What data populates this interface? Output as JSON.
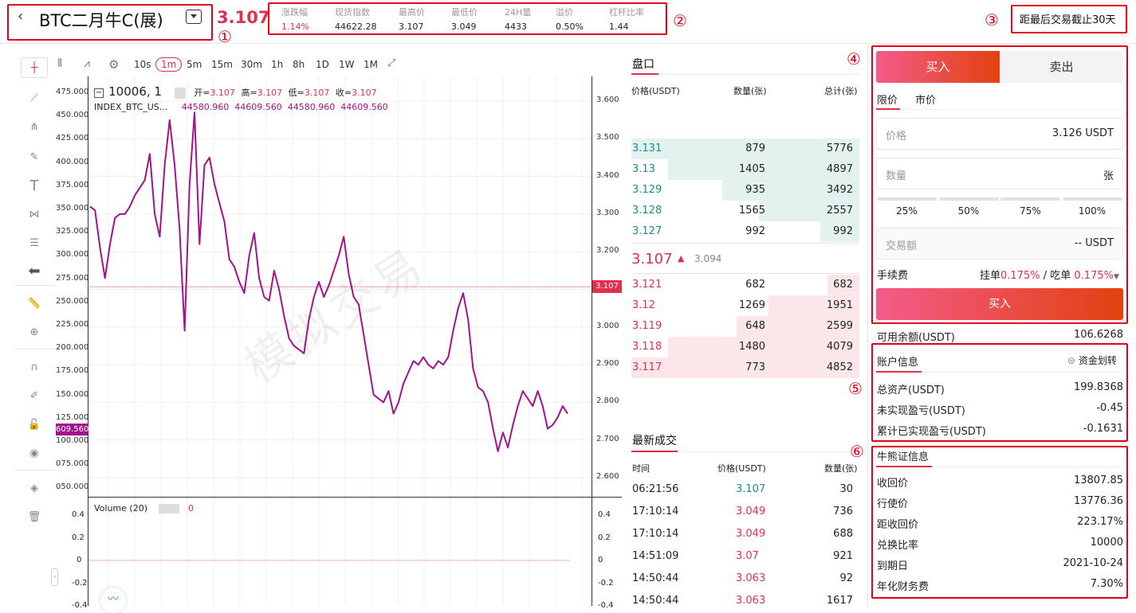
{
  "header": {
    "title": "BTC二月牛C(展)",
    "price": "3.107",
    "stats": [
      {
        "label": "涨跌幅",
        "value": "1.14%",
        "red": true
      },
      {
        "label": "现货指数",
        "value": "44622.28"
      },
      {
        "label": "最高价",
        "value": "3.107"
      },
      {
        "label": "最低价",
        "value": "3.049"
      },
      {
        "label": "24H量",
        "value": "4433"
      },
      {
        "label": "溢价",
        "value": "0.50%"
      },
      {
        "label": "杠杆比率",
        "value": "1.44"
      }
    ],
    "countdown": "距最后交易截止30天"
  },
  "markers": [
    "①",
    "②",
    "③",
    "④",
    "⑤",
    "⑥"
  ],
  "chart": {
    "timeframes": [
      "10s",
      "1m",
      "5m",
      "15m",
      "30m",
      "1h",
      "8h",
      "1D",
      "1W",
      "1M"
    ],
    "active_timeframe": "1m",
    "symbol": "10006, 1",
    "ohlc_open_label": "开=",
    "ohlc_open": "3.107",
    "ohlc_high_label": "高=",
    "ohlc_high": "3.107",
    "ohlc_low_label": "低=",
    "ohlc_low": "3.107",
    "ohlc_close_label": "收=",
    "ohlc_close": "3.107",
    "index_name": "INDEX_BTC_US...",
    "index_values": "44580.960  44609.560  44580.960  44609.560",
    "watermark": "模拟交易",
    "right_axis": [
      "3.600",
      "3.500",
      "3.400",
      "3.300",
      "3.200",
      "3.100",
      "3.000",
      "2.900",
      "2.800",
      "2.700",
      "2.600"
    ],
    "left_axis": [
      "475.000",
      "450.000",
      "425.000",
      "400.000",
      "375.000",
      "350.000",
      "325.000",
      "300.000",
      "275.000",
      "250.000",
      "225.000",
      "200.000",
      "175.000",
      "150.000",
      "125.000",
      "100.000",
      "075.000",
      "050.000"
    ],
    "current_price_tag": "3.107",
    "left_price_tag": "609.560",
    "volume_label": "Volume (20)",
    "volume_value": "0",
    "volume_axis": [
      "0.4",
      "0.2",
      "0",
      "-0.2",
      "-0.4"
    ],
    "series": [
      3.32,
      3.31,
      3.21,
      3.13,
      3.22,
      3.29,
      3.3,
      3.3,
      3.32,
      3.35,
      3.37,
      3.39,
      3.46,
      3.3,
      3.24,
      3.43,
      3.55,
      3.43,
      3.26,
      2.99,
      3.38,
      3.57,
      3.22,
      3.43,
      3.45,
      3.38,
      3.33,
      3.28,
      3.18,
      3.16,
      3.12,
      3.09,
      3.19,
      3.25,
      3.13,
      3.08,
      3.07,
      3.15,
      3.1,
      3.03,
      2.97,
      2.95,
      2.94,
      2.93,
      3.02,
      3.08,
      3.12,
      3.08,
      3.11,
      3.15,
      3.19,
      3.24,
      3.14,
      3.08,
      3.06,
      2.98,
      2.9,
      2.82,
      2.81,
      2.8,
      2.83,
      2.77,
      2.8,
      2.85,
      2.88,
      2.91,
      2.9,
      2.92,
      2.9,
      2.89,
      2.91,
      2.9,
      2.92,
      2.99,
      3.05,
      3.09,
      3.02,
      2.89,
      2.84,
      2.83,
      2.8,
      2.73,
      2.67,
      2.72,
      2.68,
      2.74,
      2.79,
      2.83,
      2.81,
      2.79,
      2.83,
      2.79,
      2.73,
      2.74,
      2.76,
      2.79,
      2.77
    ]
  },
  "orderbook": {
    "title": "盘口",
    "headers": [
      "价格(USDT)",
      "数量(张)",
      "总计(张)"
    ],
    "asks": [
      {
        "price": "3.131",
        "qty": "879",
        "total": "5776",
        "fill": 1.0
      },
      {
        "price": "3.13",
        "qty": "1405",
        "total": "4897",
        "fill": 0.84
      },
      {
        "price": "3.129",
        "qty": "935",
        "total": "3492",
        "fill": 0.6
      },
      {
        "price": "3.128",
        "qty": "1565",
        "total": "2557",
        "fill": 0.44
      },
      {
        "price": "3.127",
        "qty": "992",
        "total": "992",
        "fill": 0.17
      }
    ],
    "last_price": "3.107",
    "last_arrow": "▲",
    "index_price": "3.094",
    "bids": [
      {
        "price": "3.121",
        "qty": "682",
        "total": "682",
        "fill": 0.14
      },
      {
        "price": "3.12",
        "qty": "1269",
        "total": "1951",
        "fill": 0.4
      },
      {
        "price": "3.119",
        "qty": "648",
        "total": "2599",
        "fill": 0.54
      },
      {
        "price": "3.118",
        "qty": "1480",
        "total": "4079",
        "fill": 0.84
      },
      {
        "price": "3.117",
        "qty": "773",
        "total": "4852",
        "fill": 1.0
      }
    ]
  },
  "trades": {
    "title": "最新成交",
    "headers": [
      "时间",
      "价格(USDT)",
      "数量(张)"
    ],
    "rows": [
      {
        "time": "06:21:56",
        "price": "3.107",
        "qty": "30",
        "up": true
      },
      {
        "time": "17:10:14",
        "price": "3.049",
        "qty": "736",
        "up": false
      },
      {
        "time": "17:10:14",
        "price": "3.049",
        "qty": "688",
        "up": false
      },
      {
        "time": "14:51:09",
        "price": "3.07",
        "qty": "921",
        "up": false
      },
      {
        "time": "14:50:44",
        "price": "3.063",
        "qty": "92",
        "up": false
      },
      {
        "time": "14:50:44",
        "price": "3.063",
        "qty": "1617",
        "up": false
      }
    ]
  },
  "trade_panel": {
    "buy_tab": "买入",
    "sell_tab": "卖出",
    "limit_tab": "限价",
    "market_tab": "市价",
    "price_label": "价格",
    "price_value": "3.126 USDT",
    "qty_label": "数量",
    "qty_unit": "张",
    "percents": [
      "25%",
      "50%",
      "75%",
      "100%"
    ],
    "amount_label": "交易额",
    "amount_value": "-- USDT",
    "fee_label": "手续费",
    "fee_maker_label": "挂单",
    "fee_maker": "0.175%",
    "fee_sep": "/ 吃单",
    "fee_taker": "0.175%",
    "submit": "买入",
    "balance_label": "可用余额(USDT)",
    "balance_value": "106.6268"
  },
  "account": {
    "title": "账户信息",
    "transfer": "资金划转",
    "rows": [
      {
        "label": "总资产(USDT)",
        "value": "199.8368"
      },
      {
        "label": "未实现盈亏(USDT)",
        "value": "-0.45"
      },
      {
        "label": "累计已实现盈亏(USDT)",
        "value": "-0.1631"
      }
    ]
  },
  "cbbc": {
    "title": "牛熊证信息",
    "rows": [
      {
        "label": "收回价",
        "value": "13807.85"
      },
      {
        "label": "行使价",
        "value": "13776.36"
      },
      {
        "label": "距收回价",
        "value": "223.17%"
      },
      {
        "label": "兑换比率",
        "value": "10000"
      },
      {
        "label": "到期日",
        "value": "2021-10-24"
      },
      {
        "label": "年化财务费",
        "value": "7.30%"
      }
    ]
  },
  "colors": {
    "accent": "#e0304d",
    "green": "#1a8f85",
    "ask_bg": "#e3f1ef",
    "bid_bg": "#fbe7ea",
    "line": "#a0138c",
    "buy_grad_a": "#f45b8a",
    "buy_grad_b": "#e2410f"
  }
}
